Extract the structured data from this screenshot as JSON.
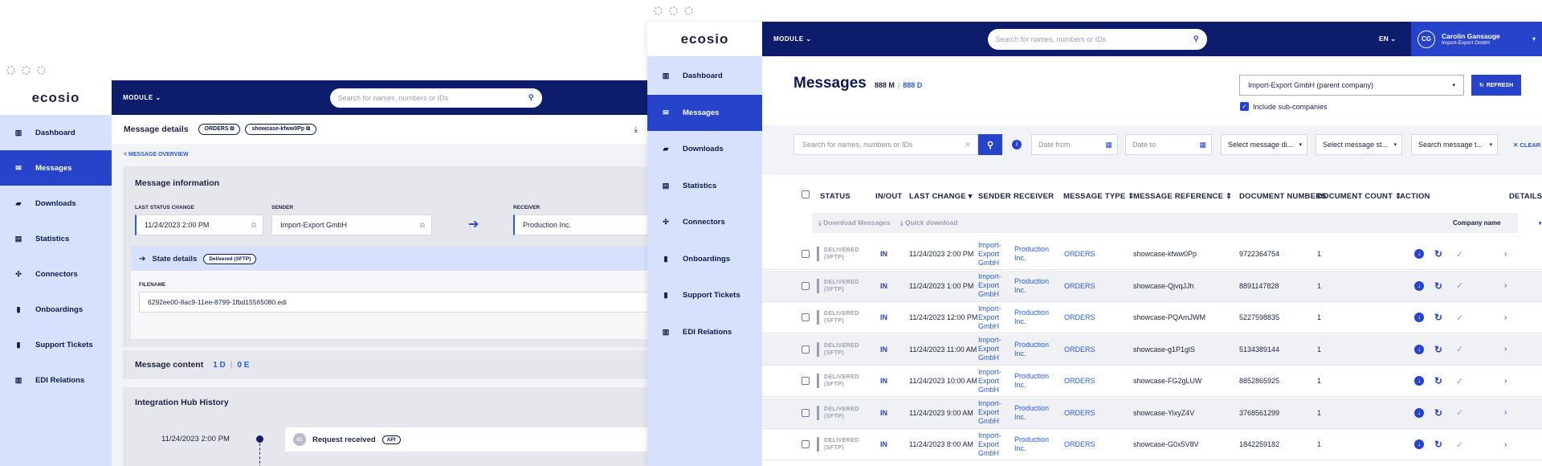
{
  "left_window": {
    "logo": "ecosio",
    "module_label": "MODULE",
    "search_placeholder": "Search for names, numbers or IDs",
    "nav": [
      "Dashboard",
      "Messages",
      "Downloads",
      "Statistics",
      "Connectors",
      "Onboardings",
      "Support Tickets",
      "EDI Relations"
    ],
    "active_nav": "Messages",
    "header_title": "Message details",
    "chip_orders": "ORDERS",
    "chip_showcase": "showcase-kfww0Pp",
    "back_link": "< MESSAGE OVERVIEW",
    "info_title": "Message information",
    "last_status_label": "LAST STATUS CHANGE",
    "last_status_value": "11/24/2023 2:00 PM",
    "sender_label": "SENDER",
    "sender_value": "Import-Export GmbH",
    "receiver_label": "RECEIVER",
    "receiver_value": "Production Inc.",
    "state_details_label": "State details",
    "state_chip": "Delivered (SFTP)",
    "filename_label": "FILENAME",
    "filename_value": "6292ee00-8ac9-11ee-8799-1fbd15565080.edi",
    "content_title": "Message content",
    "content_d": "1 D",
    "content_sep": "|",
    "content_e": "0 E",
    "history_title": "Integration Hub History",
    "history_time": "11/24/2023 2:00 PM",
    "history_step": "01",
    "history_event": "Request received",
    "history_chip": "API"
  },
  "right_window": {
    "logo": "ecosio",
    "module_label": "MODULE",
    "search_placeholder": "Search for names, numbers or IDs",
    "lang": "EN",
    "user_initials": "CG",
    "user_name": "Carolin Gansauge",
    "user_company": "Import-Export GmbH",
    "nav": [
      "Dashboard",
      "Messages",
      "Downloads",
      "Statistics",
      "Connectors",
      "Onboardings",
      "Support Tickets",
      "EDI Relations"
    ],
    "active_nav": "Messages",
    "page_title": "Messages",
    "count_m": "888 M",
    "count_sep": "|",
    "count_d": "888 D",
    "company_select": "Import-Export GmbH (parent company)",
    "refresh_label": "REFRESH",
    "include_sub": "Include sub-companies",
    "filter_search_placeholder": "Search for names, numbers or IDs",
    "date_from": "Date from",
    "date_to": "Date to",
    "select_direction": "Select message di...",
    "select_status": "Select message st...",
    "search_type": "Search message t...",
    "clear_label": "CLEAR",
    "columns": [
      "STATUS",
      "IN/OUT",
      "LAST CHANGE",
      "SENDER",
      "RECEIVER",
      "MESSAGE TYPE",
      "MESSAGE REFERENCE",
      "DOCUMENT NUMBERS",
      "DOCUMENT COUNT",
      "ACTION",
      "DETAILS"
    ],
    "download_messages": "Download Messages",
    "quick_download": "Quick download",
    "company_name": "Company name",
    "rows": [
      {
        "status": "DELIVERED (SFTP)",
        "inout": "IN",
        "last_change": "11/24/2023 2:00 PM",
        "sender": "Import-Export GmbH",
        "receiver": "Production Inc.",
        "type": "ORDERS",
        "reference": "showcase-kfww0Pp",
        "doc_number": "9722364754",
        "count": "1"
      },
      {
        "status": "DELIVERED (SFTP)",
        "inout": "IN",
        "last_change": "11/24/2023 1:00 PM",
        "sender": "Import-Export GmbH",
        "receiver": "Production Inc.",
        "type": "ORDERS",
        "reference": "showcase-QjvqJJh",
        "doc_number": "8891147828",
        "count": "1"
      },
      {
        "status": "DELIVERED (SFTP)",
        "inout": "IN",
        "last_change": "11/24/2023 12:00 PM",
        "sender": "Import-Export GmbH",
        "receiver": "Production Inc.",
        "type": "ORDERS",
        "reference": "showcase-PQAmJWM",
        "doc_number": "5227598835",
        "count": "1"
      },
      {
        "status": "DELIVERED (SFTP)",
        "inout": "IN",
        "last_change": "11/24/2023 11:00 AM",
        "sender": "Import-Export GmbH",
        "receiver": "Production Inc.",
        "type": "ORDERS",
        "reference": "showcase-g1P1glS",
        "doc_number": "5134389144",
        "count": "1"
      },
      {
        "status": "DELIVERED (SFTP)",
        "inout": "IN",
        "last_change": "11/24/2023 10:00 AM",
        "sender": "Import-Export GmbH",
        "receiver": "Production Inc.",
        "type": "ORDERS",
        "reference": "showcase-FG2gLUW",
        "doc_number": "8852865925",
        "count": "1"
      },
      {
        "status": "DELIVERED (SFTP)",
        "inout": "IN",
        "last_change": "11/24/2023 9:00 AM",
        "sender": "Import-Export GmbH",
        "receiver": "Production Inc.",
        "type": "ORDERS",
        "reference": "showcase-YixyZ4V",
        "doc_number": "3768561299",
        "count": "1"
      },
      {
        "status": "DELIVERED (SFTP)",
        "inout": "IN",
        "last_change": "11/24/2023 8:00 AM",
        "sender": "Import-Export GmbH",
        "receiver": "Production Inc.",
        "type": "ORDERS",
        "reference": "showcase-G0x5V8V",
        "doc_number": "1842259182",
        "count": "1"
      }
    ]
  },
  "colors": {
    "navy": "#0d1d6b",
    "accent": "#2643c9",
    "sidebar": "#d6e2fd",
    "link": "#2a5bd7"
  },
  "icons": [
    "chart-icon",
    "envelope-icon",
    "folder-icon",
    "table-icon",
    "plug-icon",
    "clipboard-icon",
    "ticket-icon",
    "relations-icon",
    "search-icon",
    "copy-icon",
    "arrow-right-icon",
    "info-icon",
    "calendar-icon",
    "download-icon",
    "refresh-icon",
    "check-icon",
    "chevron-right-icon",
    "close-icon"
  ]
}
